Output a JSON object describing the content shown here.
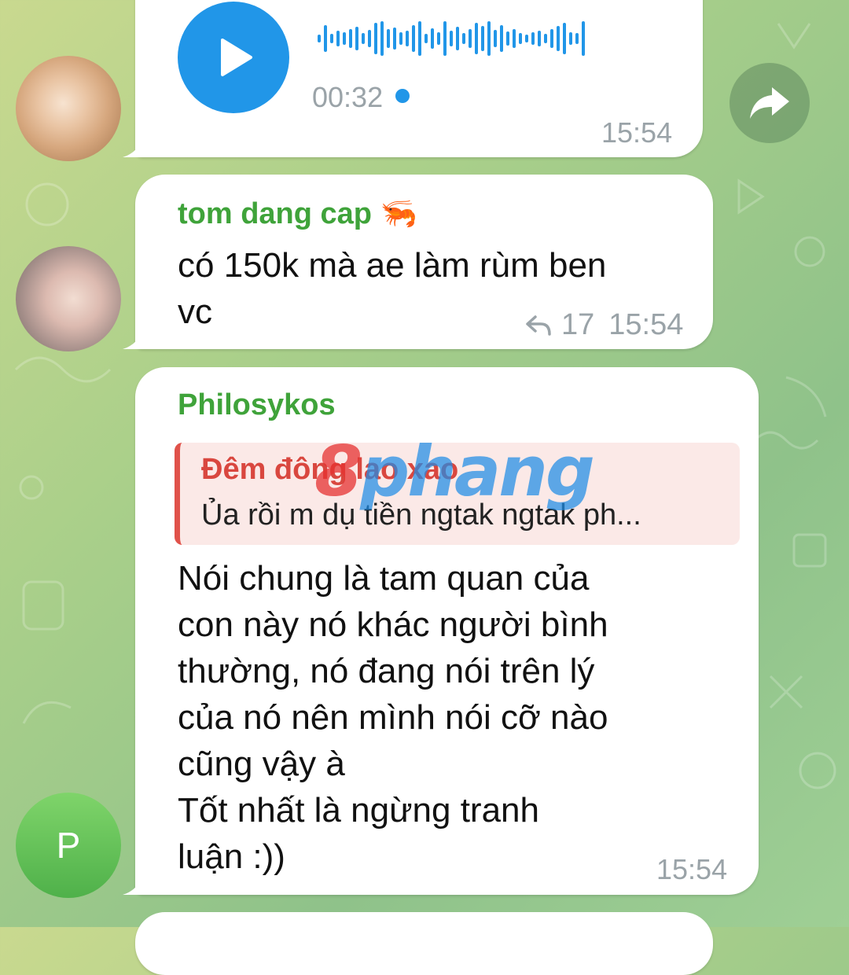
{
  "colors": {
    "accent": "#2196e8",
    "sender_name": "#3fa33a",
    "quote_author": "#d9473f",
    "bubble": "#ffffff",
    "meta_text": "#9aa3a8"
  },
  "messages": [
    {
      "type": "voice",
      "duration": "00:32",
      "time": "15:54",
      "icons": [
        "play-icon",
        "forward-icon"
      ]
    },
    {
      "type": "text",
      "sender": "tom dang cap",
      "sender_emoji": "🦐",
      "text_line1": "có 150k mà ae làm rùm ben",
      "text_line2": "vc",
      "reply_count": "17",
      "time": "15:54"
    },
    {
      "type": "text",
      "sender": "Philosykos",
      "avatar_initial": "P",
      "quote": {
        "author": "Đêm đông lao xao",
        "text": "Ủa rồi m dụ tiền ngtak ngtak ph..."
      },
      "lines": [
        "Nói chung là tam quan của",
        "con này nó khác người bình",
        "thường, nó đang nói trên lý",
        "của nó nên mình nói cỡ nào",
        "cũng vậy à",
        "Tốt nhất là ngừng tranh",
        "luận :))"
      ],
      "time": "15:54"
    }
  ],
  "watermark": {
    "first": "8",
    "rest": "phang"
  }
}
